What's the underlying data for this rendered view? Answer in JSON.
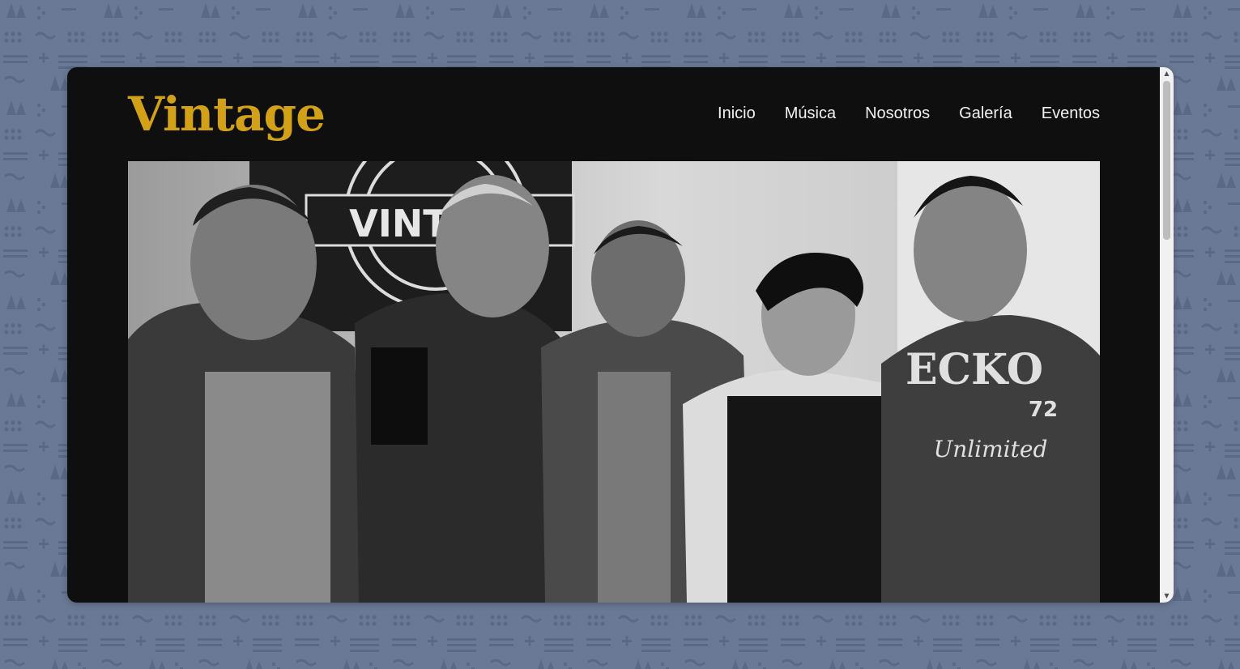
{
  "site": {
    "logo": "Vintage"
  },
  "nav": {
    "items": [
      {
        "label": "Inicio",
        "name": "nav-inicio"
      },
      {
        "label": "Música",
        "name": "nav-musica"
      },
      {
        "label": "Nosotros",
        "name": "nav-nosotros"
      },
      {
        "label": "Galería",
        "name": "nav-galeria"
      },
      {
        "label": "Eventos",
        "name": "nav-eventos"
      }
    ]
  },
  "hero": {
    "banner_text": "VINTAGE",
    "shirt_text": "ECKO",
    "shirt_number": "72",
    "shirt_script": "Unlimited"
  },
  "colors": {
    "page_background": "#6a7a96",
    "frame_background": "#0f0f10",
    "logo": "#d2a117",
    "nav_text": "#f2f2f2"
  }
}
